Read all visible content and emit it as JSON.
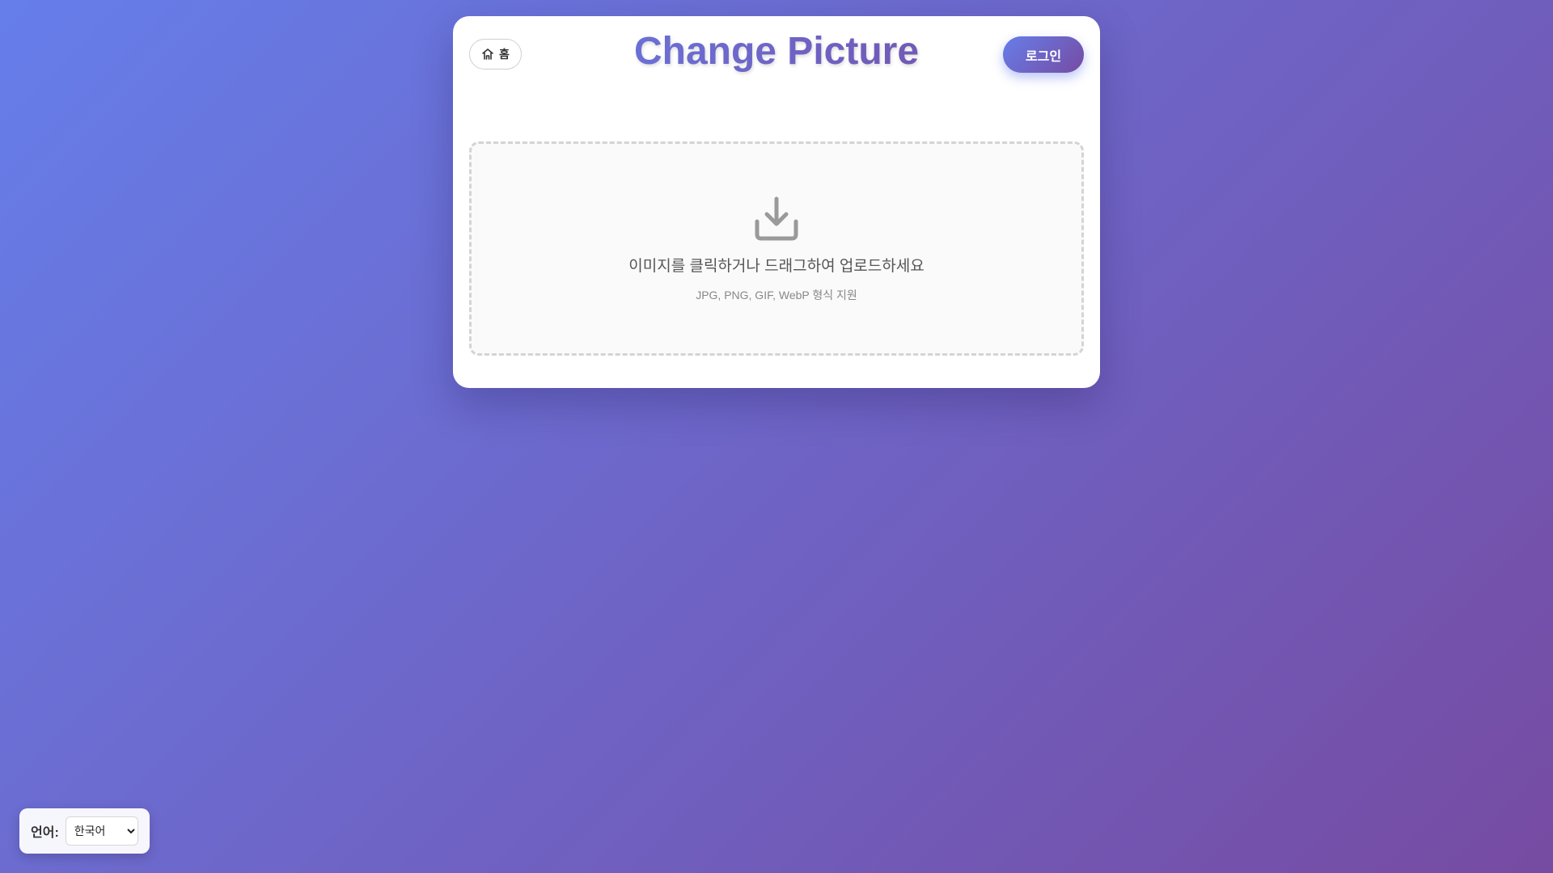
{
  "header": {
    "home_label": "홈",
    "home_icon": "home-icon",
    "title": "Change Picture",
    "login_label": "로그인"
  },
  "upload": {
    "icon": "download-icon",
    "text": "이미지를 클릭하거나 드래그하여 업로드하세요",
    "hint": "JPG, PNG, GIF, WebP 형식 지원"
  },
  "language": {
    "label": "언어:",
    "selected": "한국어"
  },
  "colors": {
    "gradient_start": "#667eea",
    "gradient_end": "#764ba2"
  }
}
